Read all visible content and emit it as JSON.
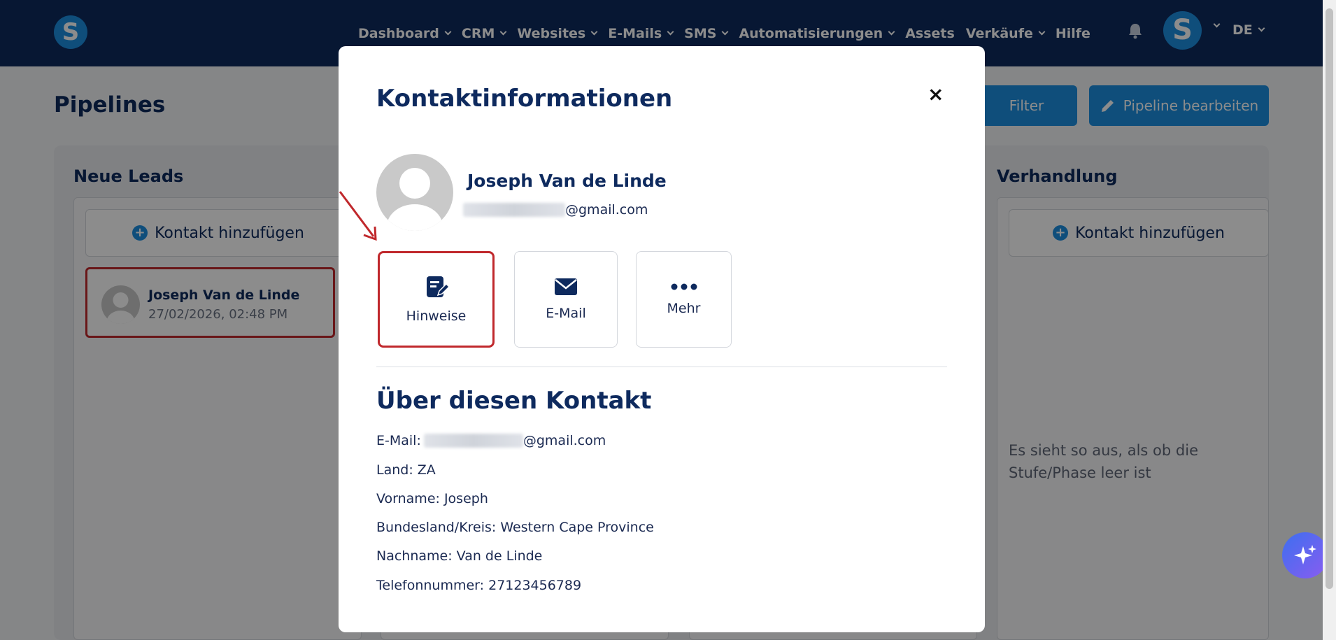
{
  "nav": {
    "logo": "S",
    "items": [
      {
        "label": "Dashboard",
        "dropdown": true
      },
      {
        "label": "CRM",
        "dropdown": true
      },
      {
        "label": "Websites",
        "dropdown": true
      },
      {
        "label": "E-Mails",
        "dropdown": true
      },
      {
        "label": "SMS",
        "dropdown": true
      },
      {
        "label": "Automatisierungen",
        "dropdown": true
      },
      {
        "label": "Assets",
        "dropdown": false
      },
      {
        "label": "Verkäufe",
        "dropdown": true
      },
      {
        "label": "Hilfe",
        "dropdown": false
      }
    ],
    "avatar": "S",
    "lang": "DE"
  },
  "page": {
    "title": "Pipelines",
    "filter_label": "Filter",
    "edit_label": "Pipeline bearbeiten"
  },
  "board": {
    "columns": [
      {
        "title": "Neue Leads",
        "add_label": "Kontakt hinzufügen"
      },
      {
        "title": "Verhandlung",
        "add_label": "Kontakt hinzufügen"
      }
    ],
    "lead": {
      "name": "Joseph Van de Linde",
      "date": "27/02/2026, 02:48 PM"
    },
    "empty_text": "Es sieht so aus, als ob die Stufe/Phase leer ist"
  },
  "modal": {
    "title": "Kontaktinformationen",
    "close": "×",
    "contact_name": "Joseph Van de Linde",
    "email_domain": "@gmail.com",
    "actions": [
      {
        "label": "Hinweise",
        "icon": "notes-icon"
      },
      {
        "label": "E-Mail",
        "icon": "envelope-icon"
      },
      {
        "label": "Mehr",
        "icon": "more-dots-icon"
      }
    ],
    "about_title": "Über diesen Kontakt",
    "info": {
      "email_label": "E-Mail:",
      "email_domain": "@gmail.com",
      "land": "Land: ZA",
      "vorname": "Vorname: Joseph",
      "bundesland": "Bundesland/Kreis: Western Cape Province",
      "nachname": "Nachname: Van de Linde",
      "telefon": "Telefonnummer: 27123456789"
    }
  },
  "colors": {
    "navy": "#0e2a5e",
    "accent": "#1d8fe1",
    "highlight": "#c0282c"
  }
}
